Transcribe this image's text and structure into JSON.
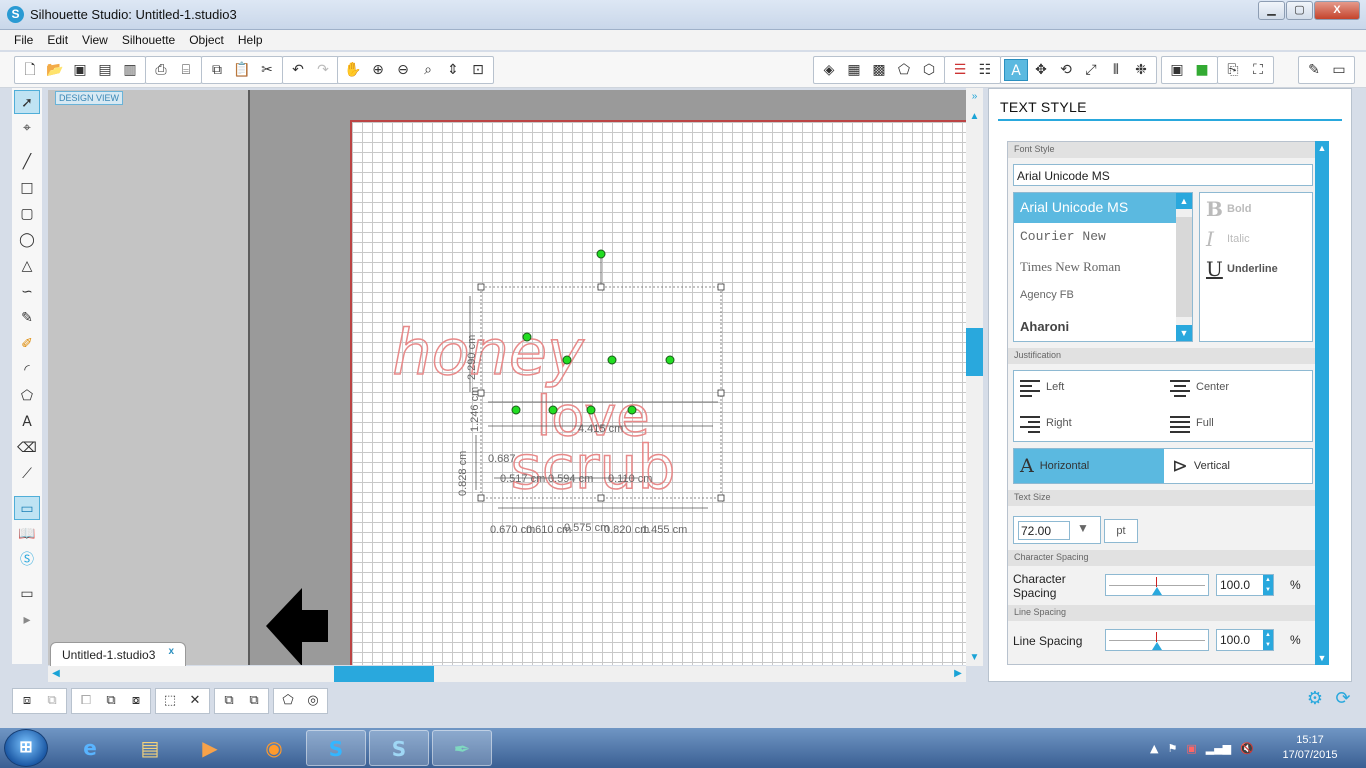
{
  "window": {
    "title": "Silhouette Studio: Untitled-1.studio3",
    "minimize": "▁",
    "maximize": "▢",
    "close": "X"
  },
  "menu": [
    "File",
    "Edit",
    "View",
    "Silhouette",
    "Object",
    "Help"
  ],
  "toolbar": {
    "groups_left": [
      [
        "new-icon",
        "open-icon",
        "save-icon",
        "save-as-icon",
        "save-library-icon"
      ],
      [
        "print-icon",
        "print-cutter-icon"
      ],
      [
        "copy-icon",
        "paste-icon",
        "cut-icon"
      ],
      [
        "undo-icon",
        "redo-icon"
      ],
      [
        "pan-icon",
        "zoom-in-icon",
        "zoom-out-icon",
        "zoom-select-icon",
        "zoom-drag-icon",
        "zoom-fit-icon"
      ]
    ],
    "groups_right": [
      [
        "fill-color-icon",
        "gradient-icon",
        "pattern-icon",
        "line-color-icon",
        "line-style-icon"
      ],
      [
        "trace-icon",
        "grid-icon"
      ],
      [
        "text-style-icon",
        "transform-icon",
        "rotate-icon",
        "scale-icon",
        "align-icon",
        "replicate-icon"
      ],
      [
        "page-setup-icon",
        "cut-settings-icon"
      ],
      [
        "send-icon",
        "registration-icon"
      ],
      [
        "library-icon",
        "store-icon"
      ]
    ],
    "active": "text-style-icon"
  },
  "left_tools": [
    "select-icon",
    "point-edit-icon",
    "line-icon",
    "rectangle-icon",
    "rounded-rectangle-icon",
    "ellipse-icon",
    "polygon-icon",
    "curve-icon",
    "freehand-icon",
    "smooth-freehand-icon",
    "arc-icon",
    "regular-polygon-icon",
    "text-icon",
    "eraser-icon",
    "knife-icon",
    "design-view-icon",
    "library-view-icon",
    "store-view-icon",
    "panel-icon",
    "play-icon"
  ],
  "workspace": {
    "design_view_label": "DESIGN VIEW",
    "doc_tab": "Untitled-1.studio3",
    "doc_tab_close": "x",
    "art_lines": [
      "honey",
      "love",
      "scrub"
    ],
    "measures": {
      "heights": [
        "2.290 cm",
        "1.246 cm",
        "0.828 cm"
      ],
      "widths": [
        "0.670 cm",
        "0.610 cm",
        "0.575 cm",
        "0.820 cm",
        "1.455 cm"
      ],
      "overlay": [
        "4.415 cm",
        "0.517 cm",
        "0.594 cm",
        "0.110 cm",
        "0.687"
      ]
    },
    "colors": {
      "art": "#e88a8a",
      "handle": "#22dd22",
      "accent": "#29a8dd"
    }
  },
  "panel": {
    "title": "TEXT STYLE",
    "font_style_header": "Font Style",
    "font_value": "Arial Unicode MS",
    "fonts": [
      "Arial Unicode MS",
      "Courier New",
      "Times New Roman",
      "Agency FB",
      "Aharoni"
    ],
    "styles": [
      {
        "glyph": "B",
        "label": "Bold",
        "enabled": false
      },
      {
        "glyph": "I",
        "label": "Italic",
        "enabled": false
      },
      {
        "glyph": "U",
        "label": "Underline",
        "enabled": true
      }
    ],
    "justification_header": "Justification",
    "justification": [
      "Left",
      "Center",
      "Right",
      "Full"
    ],
    "orientation": [
      "Horizontal",
      "Vertical"
    ],
    "text_size_header": "Text Size",
    "text_size": "72.00",
    "text_size_unit": "pt",
    "char_spacing_header": "Character Spacing",
    "char_spacing_label": "Character Spacing",
    "char_spacing_value": "100.0",
    "line_spacing_header": "Line Spacing",
    "line_spacing_label": "Line Spacing",
    "line_spacing_value": "100.0",
    "percent": "%"
  },
  "taskbar": {
    "apps": [
      "internet-explorer-icon",
      "file-explorer-icon",
      "media-player-icon",
      "firefox-icon",
      "skype-icon",
      "silhouette-studio-icon",
      "quill-icon"
    ],
    "time": "15:17",
    "date": "17/07/2015"
  }
}
